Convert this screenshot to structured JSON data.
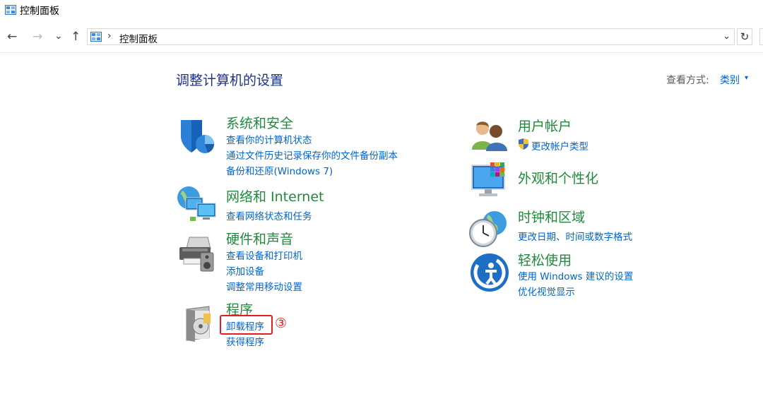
{
  "window": {
    "title": "控制面板"
  },
  "address_bar": {
    "back_icon": "←",
    "forward_icon": "→",
    "recent_icon": "⌄",
    "up_icon": "↑",
    "separator": "›",
    "crumb": "控制面板",
    "dropdown_icon": "⌄",
    "refresh_icon": "↻"
  },
  "main": {
    "title": "调整计算机的设置",
    "view_by_label": "查看方式:",
    "view_by_value": "类别",
    "view_by_caret": "▾"
  },
  "left_categories": [
    {
      "name": "系统和安全",
      "icon": "shield-icon",
      "links": [
        "查看你的计算机状态",
        "通过文件历史记录保存你的文件备份副本",
        "备份和还原(Windows 7)"
      ]
    },
    {
      "name": "网络和 Internet",
      "icon": "network-icon",
      "links": [
        "查看网络状态和任务"
      ]
    },
    {
      "name": "硬件和声音",
      "icon": "printer-icon",
      "links": [
        "查看设备和打印机",
        "添加设备",
        "调整常用移动设置"
      ]
    },
    {
      "name": "程序",
      "icon": "programs-icon",
      "links": [
        "卸载程序",
        "获得程序"
      ]
    }
  ],
  "right_categories": [
    {
      "name": "用户帐户",
      "icon": "users-icon",
      "links": [
        "更改帐户类型"
      ]
    },
    {
      "name": "外观和个性化",
      "icon": "monitor-icon",
      "links": []
    },
    {
      "name": "时钟和区域",
      "icon": "clock-icon",
      "links": [
        "更改日期、时间或数字格式"
      ]
    },
    {
      "name": "轻松使用",
      "icon": "ease-of-access-icon",
      "links": [
        "使用 Windows 建议的设置",
        "优化视觉显示"
      ]
    }
  ],
  "annotation": {
    "step": "③",
    "color": "#e02020"
  },
  "colors": {
    "link": "#0066cc",
    "category": "#1f8a3c",
    "title": "#1e3287"
  }
}
